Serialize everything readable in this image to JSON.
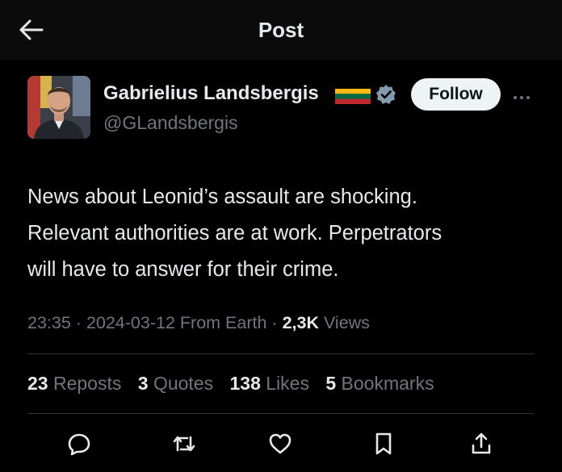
{
  "header": {
    "title": "Post"
  },
  "author": {
    "display_name": "Gabrielius Landsbergis",
    "handle": "@GLandsbergis",
    "follow_label": "Follow"
  },
  "post": {
    "text_lines": [
      "News about Leonid’s assault are shocking.",
      "Relevant authorities are at work. Perpetrators",
      "will have to answer for their crime."
    ],
    "time": "23:35",
    "date": "2024-03-12",
    "location": "From Earth",
    "views_count": "2,3K",
    "views_label": "Views"
  },
  "stats": {
    "reposts_count": "23",
    "reposts_label": "Reposts",
    "quotes_count": "3",
    "quotes_label": "Quotes",
    "likes_count": "138",
    "likes_label": "Likes",
    "bookmarks_count": "5",
    "bookmarks_label": "Bookmarks"
  },
  "colors": {
    "background": "#000000",
    "text_primary": "#e7e9ea",
    "text_secondary": "#71767b",
    "verified_badge": "#829aab",
    "flag_yellow": "#fdb913",
    "flag_green": "#006a44",
    "flag_red": "#c1272d"
  },
  "icons": {
    "back": "arrow-left-icon",
    "verified": "verified-badge-icon",
    "more": "more-horizontal-icon",
    "reply": "reply-icon",
    "repost": "repost-icon",
    "like": "heart-icon",
    "bookmark": "bookmark-icon",
    "share": "share-icon"
  }
}
